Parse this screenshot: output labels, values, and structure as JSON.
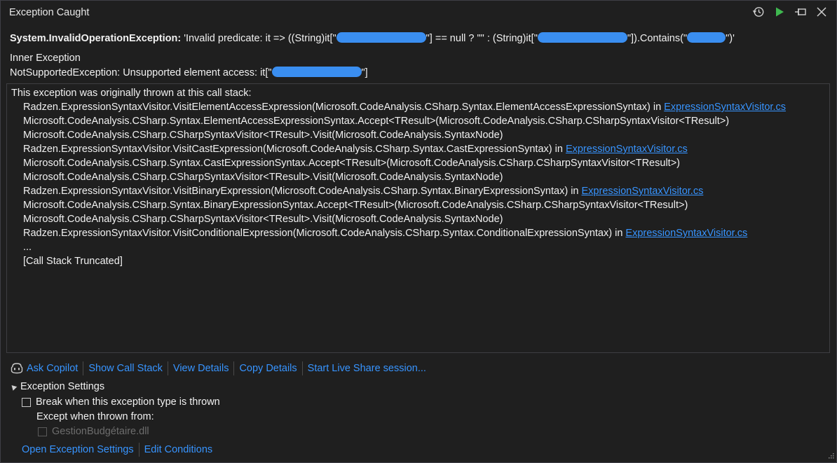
{
  "window": {
    "title": "Exception Caught"
  },
  "exception": {
    "type": "System.InvalidOperationException:",
    "msg_1": "'Invalid predicate: it => ((String)it[\"",
    "msg_2": "\"] == null ? \"\" : (String)it[\"",
    "msg_3": "\"]).Contains(\"",
    "msg_4": "\")'"
  },
  "inner": {
    "title": "Inner Exception",
    "message_prefix": "NotSupportedException: Unsupported element access: it[\"",
    "message_suffix": "\"]"
  },
  "stack": {
    "header": "This exception was originally thrown at this call stack:",
    "frames": [
      {
        "text": "Radzen.ExpressionSyntaxVisitor.VisitElementAccessExpression(Microsoft.CodeAnalysis.CSharp.Syntax.ElementAccessExpressionSyntax) in ",
        "file": "ExpressionSyntaxVisitor.cs"
      },
      {
        "text": "Microsoft.CodeAnalysis.CSharp.Syntax.ElementAccessExpressionSyntax.Accept<TResult>(Microsoft.CodeAnalysis.CSharp.CSharpSyntaxVisitor<TResult>)",
        "file": ""
      },
      {
        "text": "Microsoft.CodeAnalysis.CSharp.CSharpSyntaxVisitor<TResult>.Visit(Microsoft.CodeAnalysis.SyntaxNode)",
        "file": ""
      },
      {
        "text": "Radzen.ExpressionSyntaxVisitor.VisitCastExpression(Microsoft.CodeAnalysis.CSharp.Syntax.CastExpressionSyntax) in ",
        "file": "ExpressionSyntaxVisitor.cs"
      },
      {
        "text": "Microsoft.CodeAnalysis.CSharp.Syntax.CastExpressionSyntax.Accept<TResult>(Microsoft.CodeAnalysis.CSharp.CSharpSyntaxVisitor<TResult>)",
        "file": ""
      },
      {
        "text": "Microsoft.CodeAnalysis.CSharp.CSharpSyntaxVisitor<TResult>.Visit(Microsoft.CodeAnalysis.SyntaxNode)",
        "file": ""
      },
      {
        "text": "Radzen.ExpressionSyntaxVisitor.VisitBinaryExpression(Microsoft.CodeAnalysis.CSharp.Syntax.BinaryExpressionSyntax) in ",
        "file": "ExpressionSyntaxVisitor.cs"
      },
      {
        "text": "Microsoft.CodeAnalysis.CSharp.Syntax.BinaryExpressionSyntax.Accept<TResult>(Microsoft.CodeAnalysis.CSharp.CSharpSyntaxVisitor<TResult>)",
        "file": ""
      },
      {
        "text": "Microsoft.CodeAnalysis.CSharp.CSharpSyntaxVisitor<TResult>.Visit(Microsoft.CodeAnalysis.SyntaxNode)",
        "file": ""
      },
      {
        "text": "Radzen.ExpressionSyntaxVisitor.VisitConditionalExpression(Microsoft.CodeAnalysis.CSharp.Syntax.ConditionalExpressionSyntax) in ",
        "file": "ExpressionSyntaxVisitor.cs"
      },
      {
        "text": "...",
        "file": ""
      },
      {
        "text": "[Call Stack Truncated]",
        "file": ""
      }
    ]
  },
  "actions": {
    "ask_copilot": "Ask Copilot",
    "show_call_stack": "Show Call Stack",
    "view_details": "View Details",
    "copy_details": "Copy Details",
    "live_share": "Start Live Share session..."
  },
  "settings": {
    "title": "Exception Settings",
    "break_label": "Break when this exception type is thrown",
    "except_label": "Except when thrown from:",
    "dll_label": "GestionBudgétaire.dll",
    "open_settings": "Open Exception Settings",
    "edit_conditions": "Edit Conditions"
  },
  "colors": {
    "link": "#3794ff",
    "redaction": "#3a8ef0",
    "play": "#3fb950"
  },
  "icons": [
    "history-icon",
    "play-icon",
    "pin-icon",
    "close-icon",
    "copilot-icon",
    "collapse-triangle-icon",
    "resize-grip-icon"
  ]
}
